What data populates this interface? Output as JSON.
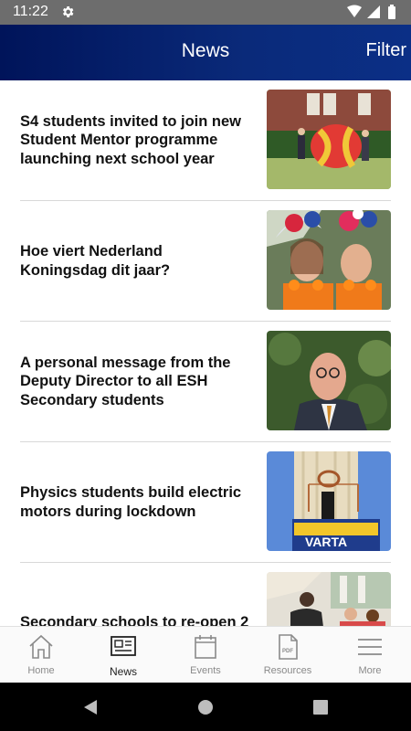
{
  "status_bar": {
    "time": "11:22",
    "icons": [
      "gear-icon",
      "wifi-icon",
      "signal-icon",
      "battery-icon"
    ]
  },
  "header": {
    "title": "News",
    "filter_label": "Filter",
    "gradient_start": "#00145a",
    "gradient_end": "#0b2f86"
  },
  "news": [
    {
      "title": "S4 students invited to join new Student Mentor programme launching next school year"
    },
    {
      "title": "Hoe viert Nederland Koningsdag dit jaar?"
    },
    {
      "title": "A personal message from the Deputy Director to all ESH Secondary students"
    },
    {
      "title": "Physics students build electric motors during lockdown"
    },
    {
      "title": "Secondary schools to re-open 2"
    }
  ],
  "battery_text": "VARTA",
  "bottom_nav": [
    {
      "label": "Home",
      "icon": "home-icon"
    },
    {
      "label": "News",
      "icon": "newspaper-icon",
      "active": true
    },
    {
      "label": "Events",
      "icon": "calendar-icon"
    },
    {
      "label": "Resources",
      "icon": "pdf-icon",
      "pdf_text": "PDF"
    },
    {
      "label": "More",
      "icon": "menu-icon"
    }
  ],
  "system_nav": [
    "back-button",
    "home-button",
    "recents-button"
  ]
}
